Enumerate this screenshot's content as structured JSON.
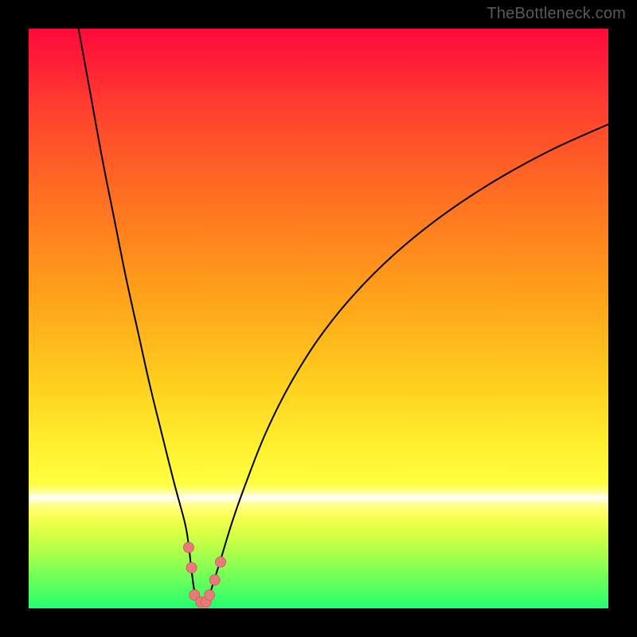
{
  "watermark": "TheBottleneck.com",
  "colors": {
    "frame": "#000000",
    "watermark": "#595959",
    "curve": "#000000",
    "dot_fill": "#e77b79",
    "dot_stroke": "#d85e5d"
  },
  "chart_data": {
    "type": "line",
    "title": "",
    "xlabel": "",
    "ylabel": "",
    "xlim": [
      0,
      100
    ],
    "ylim": [
      0,
      100
    ],
    "note": "Values are unlabeled percentages of the plot area; y=0 is the bottom (green), y=100 is the top (red). The curve is a V-shaped bottleneck profile with its minimum at the highlighted-point cluster.",
    "series": [
      {
        "name": "bottleneck-curve",
        "x": [
          8.6,
          10.7,
          12.7,
          14.8,
          16.8,
          18.9,
          20.9,
          23.0,
          25.0,
          27.0,
          27.7,
          28.1,
          28.8,
          29.8,
          30.8,
          31.1,
          33.0,
          35.3,
          38.0,
          41.0,
          45.0,
          50.0,
          56.0,
          63.0,
          71.0,
          80.0,
          90.0,
          100.0
        ],
        "y": [
          100.0,
          88.5,
          77.5,
          67.0,
          57.0,
          47.5,
          38.5,
          30.0,
          22.0,
          14.5,
          10.0,
          6.5,
          2.0,
          0.7,
          0.7,
          2.0,
          8.0,
          15.5,
          23.0,
          30.5,
          38.5,
          46.5,
          54.0,
          61.0,
          67.5,
          73.5,
          79.0,
          83.5
        ]
      }
    ],
    "highlighted_points": [
      {
        "x": 27.6,
        "y": 10.5
      },
      {
        "x": 28.1,
        "y": 7.0
      },
      {
        "x": 28.6,
        "y": 2.3
      },
      {
        "x": 29.7,
        "y": 1.1
      },
      {
        "x": 30.6,
        "y": 1.1
      },
      {
        "x": 31.2,
        "y": 2.3
      },
      {
        "x": 32.1,
        "y": 4.9
      },
      {
        "x": 33.1,
        "y": 8.0
      }
    ],
    "dot_radius_px": 6.5
  }
}
